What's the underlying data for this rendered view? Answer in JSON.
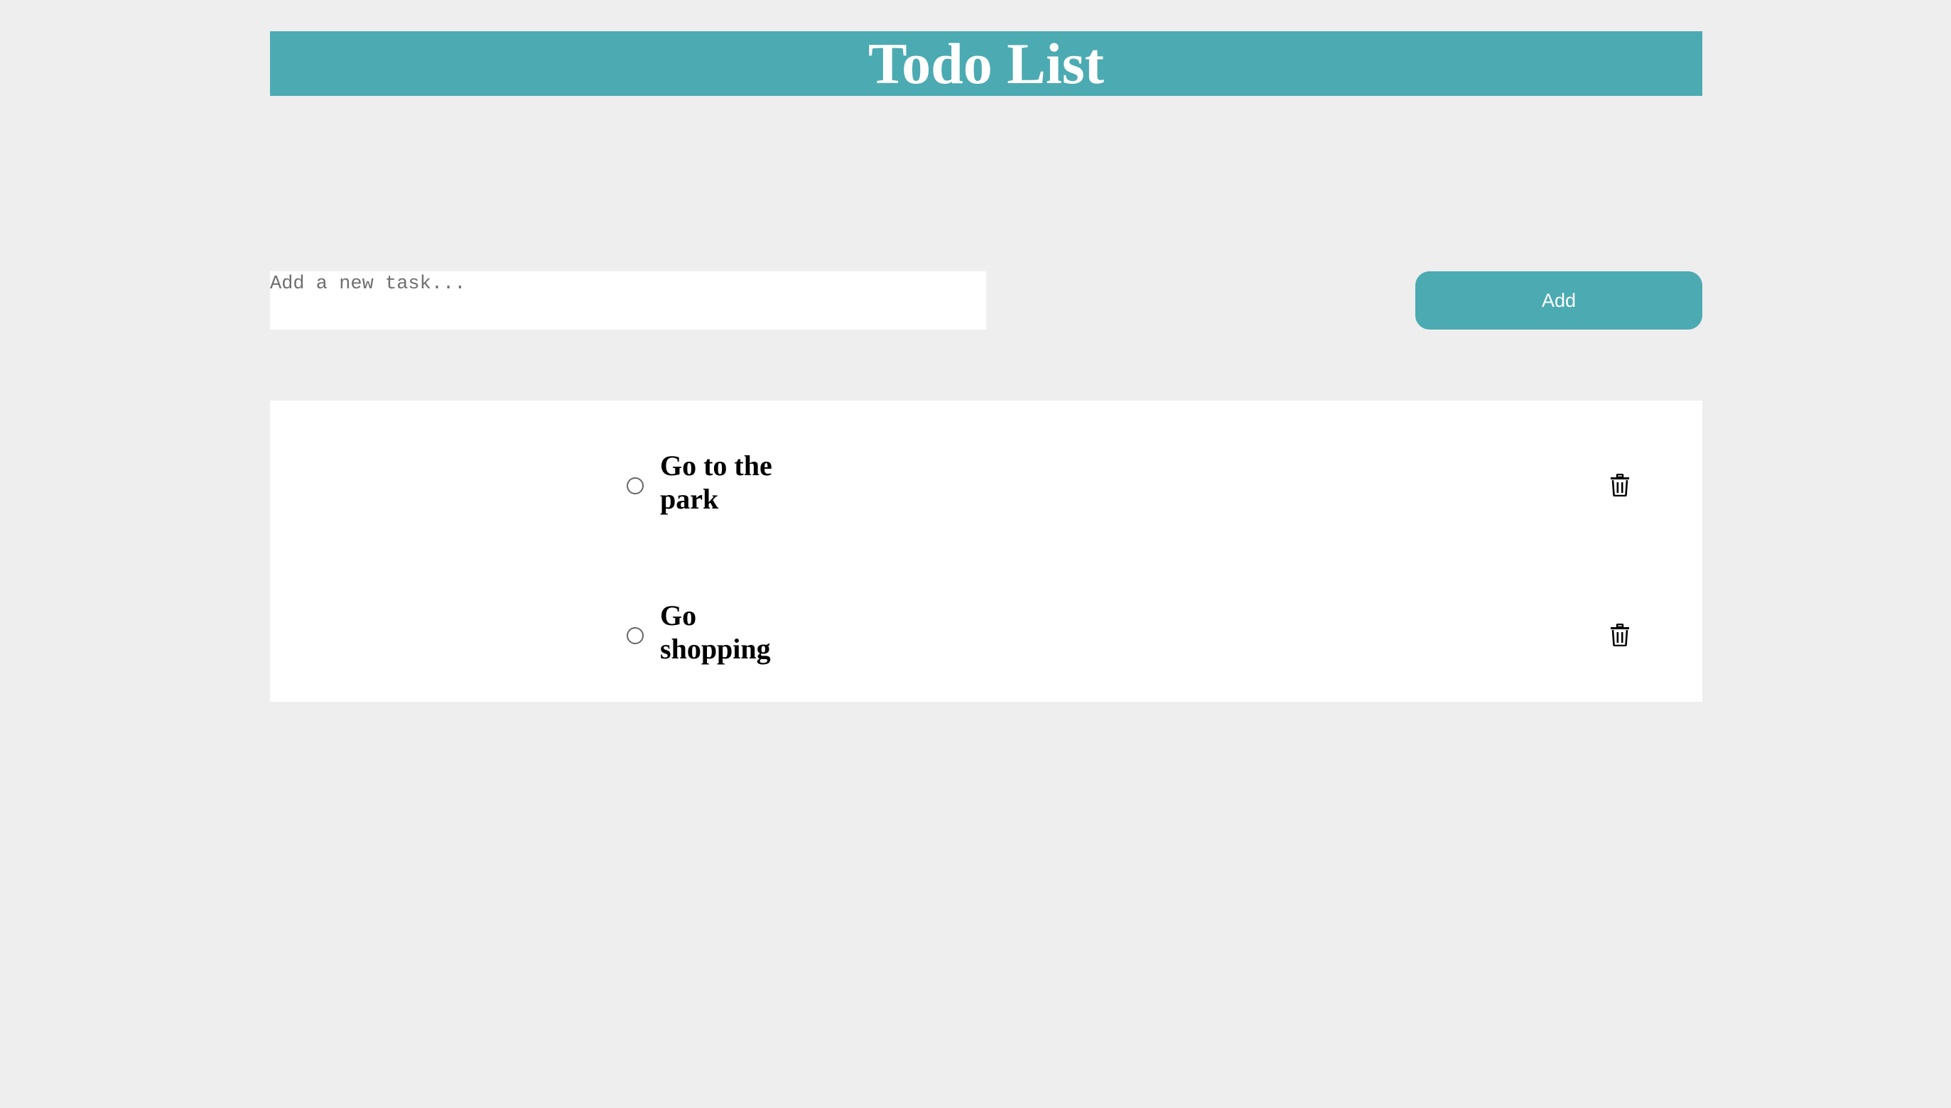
{
  "header": {
    "title": "Todo List"
  },
  "new_task": {
    "placeholder": "Add a new task...",
    "value": "",
    "add_label": "Add"
  },
  "todos": [
    {
      "label": "Go to the park",
      "completed": false
    },
    {
      "label": "Go shopping",
      "completed": false
    }
  ],
  "colors": {
    "accent": "#4caab2",
    "background": "#eeeeee",
    "panel": "#ffffff",
    "text": "#000000"
  },
  "icons": {
    "checkbox": "radio-circle-icon",
    "delete": "trash-icon"
  }
}
